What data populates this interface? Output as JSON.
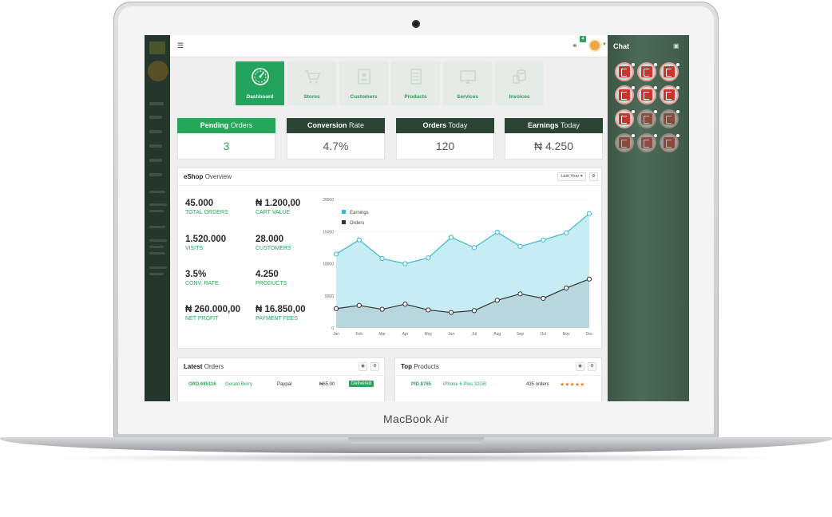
{
  "laptop": {
    "brand_label": "MacBook Air"
  },
  "topbar": {
    "notification_count": "4"
  },
  "tiles": [
    {
      "label": "Dashboard",
      "icon": "speedometer-icon",
      "active": true
    },
    {
      "label": "Stores",
      "icon": "cart-icon",
      "active": false
    },
    {
      "label": "Customers",
      "icon": "contact-card-icon",
      "active": false
    },
    {
      "label": "Products",
      "icon": "product-list-icon",
      "active": false
    },
    {
      "label": "Services",
      "icon": "monitor-icon",
      "active": false
    },
    {
      "label": "Invoices",
      "icon": "invoice-icon",
      "active": false
    }
  ],
  "stats": [
    {
      "bold": "Pending",
      "light": "Orders",
      "value": "3"
    },
    {
      "bold": "Conversion",
      "light": "Rate",
      "value": "4.7%"
    },
    {
      "bold": "Orders",
      "light": "Today",
      "value": "120"
    },
    {
      "bold": "Earnings",
      "light": "Today",
      "value": "₦ 4.250"
    }
  ],
  "overview": {
    "title_bold": "eShop",
    "title_light": "Overview",
    "period_select": "Last Year ▾",
    "kpis": [
      {
        "value": "45.000",
        "label": "TOTAL ORDERS"
      },
      {
        "value": "₦ 1.200,00",
        "label": "CART VALUE"
      },
      {
        "value": "1.520.000",
        "label": "VISITS"
      },
      {
        "value": "28.000",
        "label": "CUSTOMERS"
      },
      {
        "value": "3.5%",
        "label": "CONV. RATE"
      },
      {
        "value": "4.250",
        "label": "PRODUCTS"
      },
      {
        "value": "₦ 260.000,00",
        "label": "NET PROFIT"
      },
      {
        "value": "₦ 16.850,00",
        "label": "PAYMENT FEES"
      }
    ]
  },
  "chart_data": {
    "type": "area",
    "categories": [
      "Jan",
      "Feb",
      "Mar",
      "Apr",
      "May",
      "Jun",
      "Jul",
      "Aug",
      "Sep",
      "Oct",
      "Nov",
      "Dec"
    ],
    "series": [
      {
        "name": "Earnings",
        "color": "#39b8d1",
        "values": [
          11500,
          13700,
          10800,
          10000,
          10900,
          14100,
          12500,
          14900,
          12700,
          13700,
          14800,
          17800
        ]
      },
      {
        "name": "Orders",
        "color": "#333333",
        "values": [
          3000,
          3500,
          2900,
          3700,
          2800,
          2400,
          2700,
          4300,
          5300,
          4600,
          6200,
          7600
        ]
      }
    ],
    "yticks": [
      "20000",
      "15000",
      "10000",
      "5000",
      "0"
    ],
    "ylim": [
      0,
      20000
    ],
    "legend_position": "top-left"
  },
  "latest_orders": {
    "title_bold": "Latest",
    "title_light": "Orders",
    "rows": [
      {
        "id": "ORD.685116",
        "customer": "Gerald Berry",
        "method": "Paypal",
        "amount": "₦65,00",
        "status": "Delivered"
      }
    ]
  },
  "top_products": {
    "title_bold": "Top",
    "title_light": "Products",
    "rows": [
      {
        "id": "PID.8765",
        "name": "iPhone 6 Plus 32GB",
        "orders": "435 orders",
        "rating": "★★★★★"
      }
    ]
  },
  "chat": {
    "title": "Chat"
  }
}
